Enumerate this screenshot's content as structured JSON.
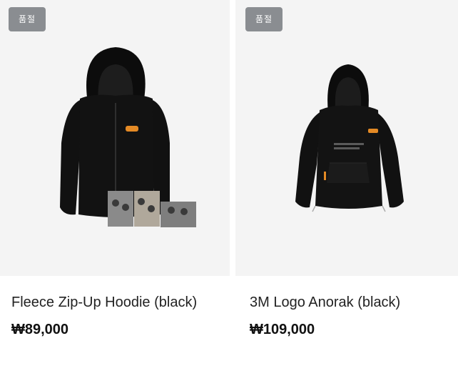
{
  "products": [
    {
      "badge": "품절",
      "name": "Fleece Zip-Up Hoodie (black)",
      "price": "₩89,000",
      "image_icon": "hoodie-with-photocards-image"
    },
    {
      "badge": "품절",
      "name": "3M Logo Anorak (black)",
      "price": "₩109,000",
      "image_icon": "anorak-jacket-image"
    }
  ],
  "colors": {
    "tile_background": "#f4f4f4",
    "badge_background": "#8a8d91",
    "garment": "#111111",
    "accent_orange": "#e48a25"
  }
}
